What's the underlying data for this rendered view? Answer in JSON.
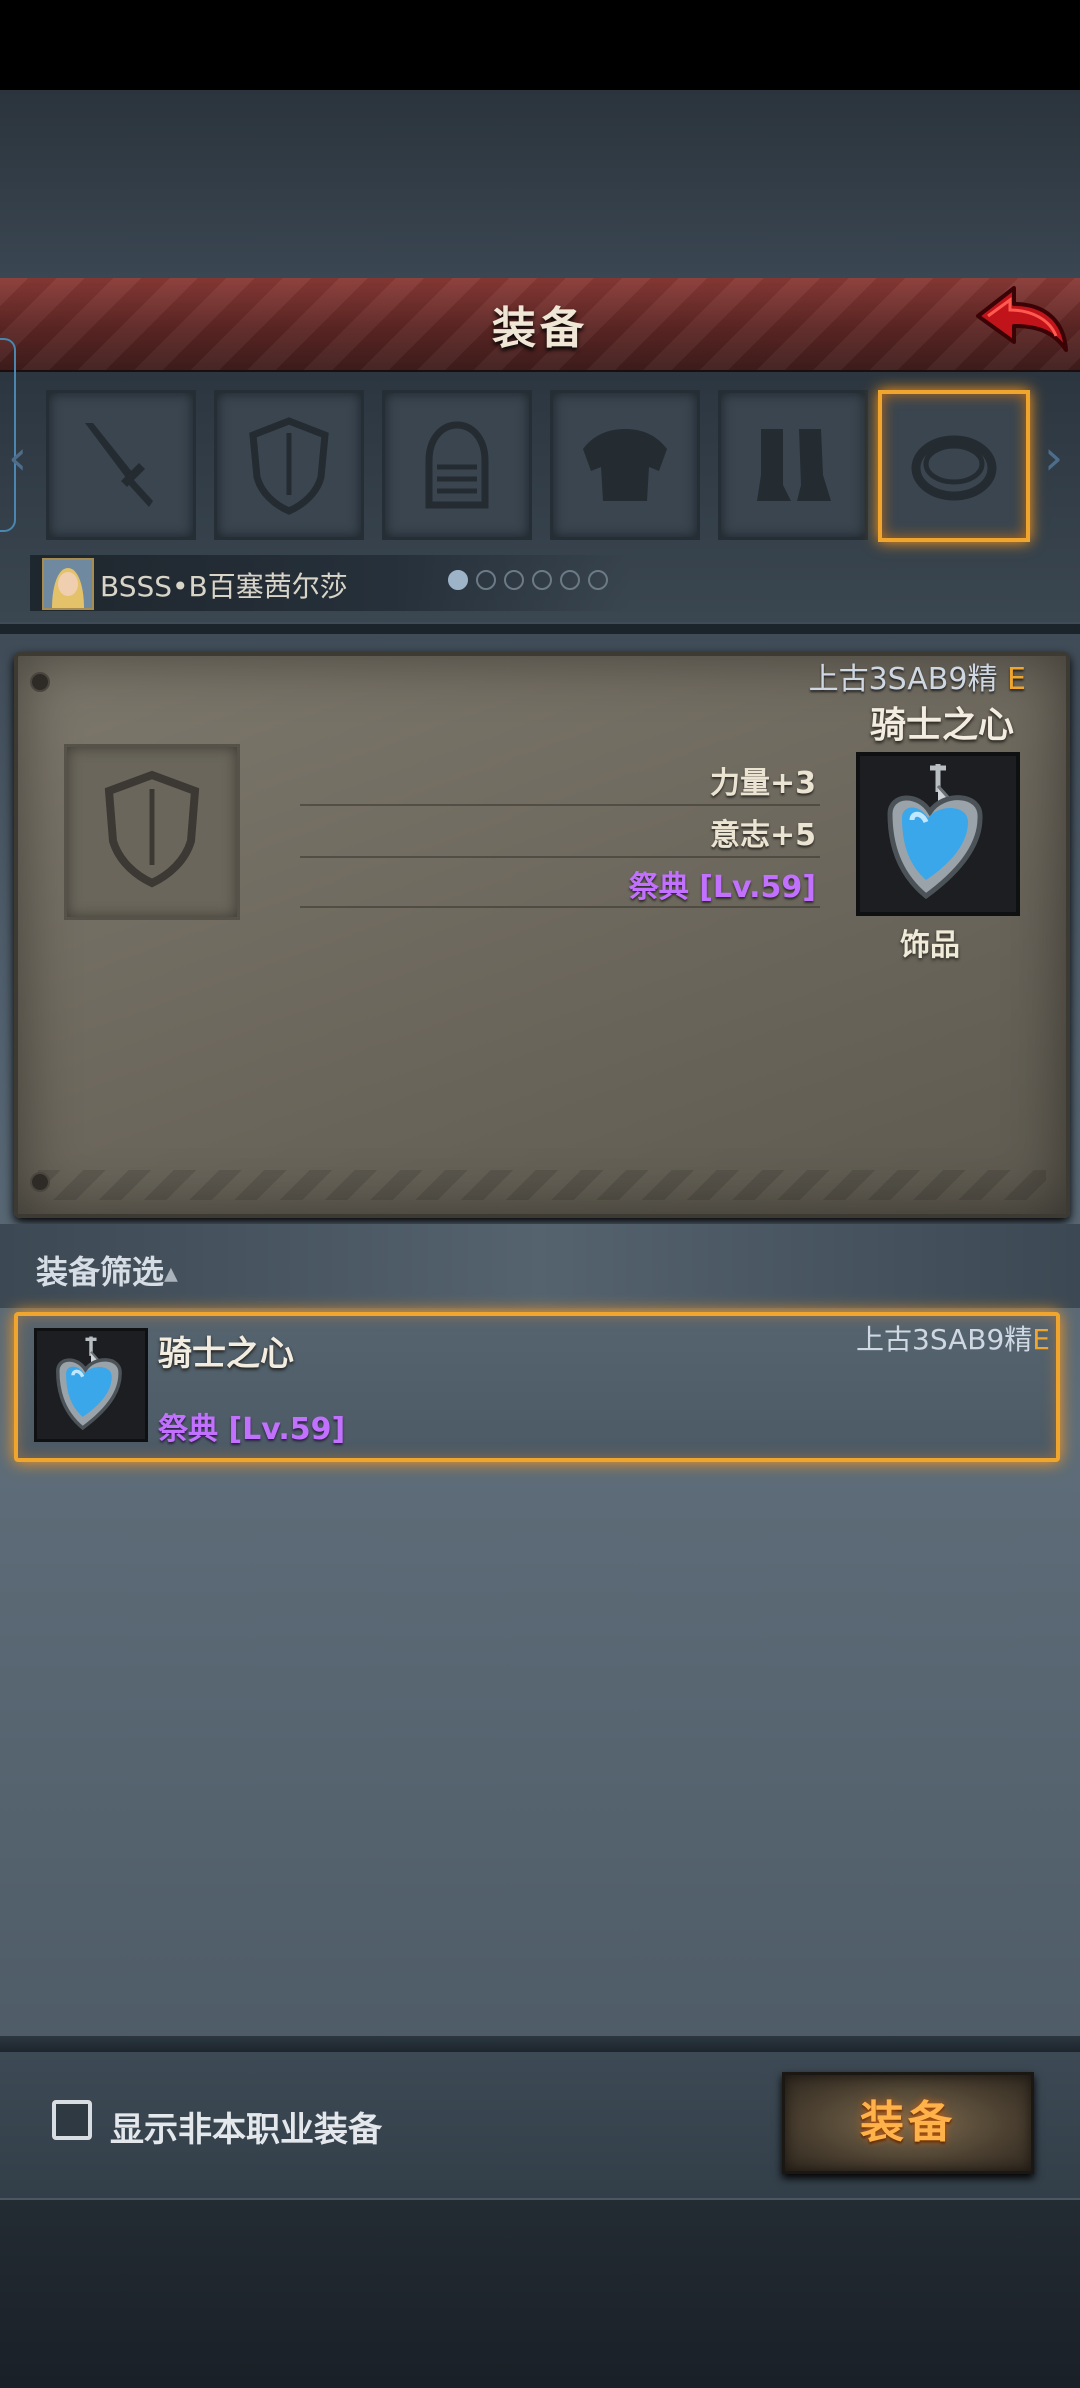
{
  "screen": {
    "title": "装备"
  },
  "hero": {
    "name": "BSSS•B百塞茜尔莎"
  },
  "slots": [
    {
      "name": "weapon"
    },
    {
      "name": "shield"
    },
    {
      "name": "helmet"
    },
    {
      "name": "armor"
    },
    {
      "name": "boots"
    },
    {
      "name": "ring",
      "selected": true
    }
  ],
  "page_dots": {
    "count": 6,
    "active": 1
  },
  "detail": {
    "grade_prefix": "上古3SAB9精",
    "grade_suffix": "E",
    "item_name": "骑士之心",
    "stats": [
      "力量+3",
      "意志+5"
    ],
    "set_name": "祭典 [Lv.59]",
    "item_type": "饰品"
  },
  "filter": {
    "label": "装备筛选",
    "toggle_glyph": "▲"
  },
  "list": [
    {
      "name": "骑士之心",
      "set_name": "祭典 [Lv.59]",
      "grade_prefix": "上古3SAB9精",
      "grade_suffix": "E"
    }
  ],
  "footer": {
    "checkbox_label": "显示非本职业装备",
    "checkbox_checked": false,
    "equip_button": "装备"
  },
  "colors": {
    "accent_orange": "#f0a52e",
    "set_purple": "#c271ff",
    "title_red": "#8a3a36"
  }
}
